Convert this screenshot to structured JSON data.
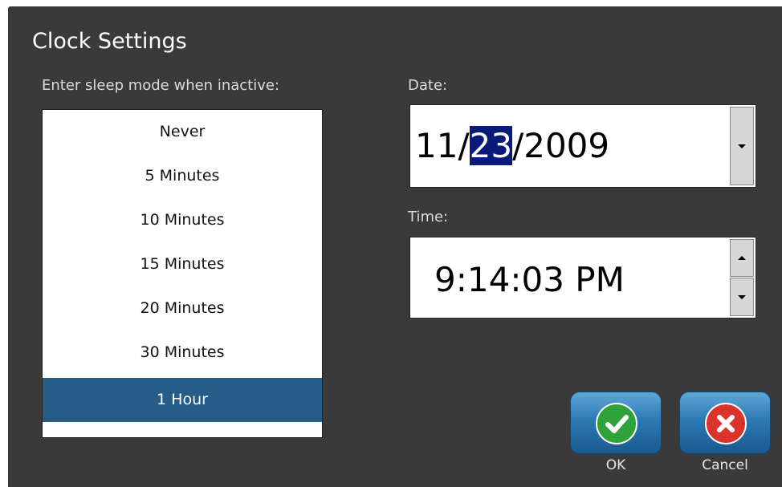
{
  "dialog": {
    "title": "Clock Settings"
  },
  "sleep": {
    "label": "Enter sleep mode when inactive:",
    "options": [
      "Never",
      "5 Minutes",
      "10 Minutes",
      "15 Minutes",
      "20 Minutes",
      "30 Minutes",
      "1 Hour"
    ],
    "selected": "1 Hour"
  },
  "date": {
    "label": "Date:",
    "month": "11",
    "sep1": "/",
    "day": "23",
    "sep2": "/",
    "year": "2009",
    "selected_segment": "day",
    "dropdown_icon": "chevron-down-icon"
  },
  "time": {
    "label": "Time:",
    "value": "9:14:03 PM",
    "up_icon": "triangle-up-icon",
    "down_icon": "triangle-down-icon"
  },
  "buttons": {
    "ok_label": "OK",
    "ok_icon": "checkmark-icon",
    "cancel_label": "Cancel",
    "cancel_icon": "x-icon"
  },
  "colors": {
    "dialog_bg": "#3a3a3a",
    "selection": "#255d88",
    "text_highlight": "#0a1a7a",
    "ok_green": "#2fa33a",
    "cancel_red": "#d9342b",
    "button_blue": "#2c79b3"
  }
}
